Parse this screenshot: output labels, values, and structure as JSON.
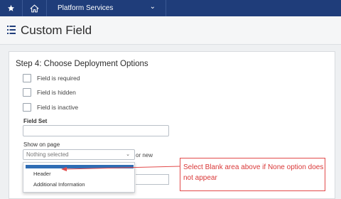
{
  "topbar": {
    "star_icon": "star-icon",
    "home_icon": "home-icon",
    "menu_label": "Platform Services",
    "menu_chevron": "chevron-down-icon"
  },
  "header": {
    "icon": "list-icon",
    "title": "Custom Field"
  },
  "form": {
    "step_title": "Step 4: Choose Deployment Options",
    "checkboxes": [
      {
        "label": "Field is required",
        "checked": false
      },
      {
        "label": "Field is hidden",
        "checked": false
      },
      {
        "label": "Field is inactive",
        "checked": false
      }
    ],
    "field_set": {
      "label": "Field Set",
      "value": ""
    },
    "show_on_page": {
      "label": "Show on page",
      "selected": "Nothing selected",
      "or_new": "or new",
      "options": [
        "Header",
        "Additional Information"
      ],
      "highlight_color": "#2f6db4"
    }
  },
  "annotation": {
    "text": "Select Blank area above if None option does not appear",
    "color": "#d93838"
  },
  "colors": {
    "nav_bg": "#1f3d7a",
    "page_bg": "#eef0f2"
  }
}
